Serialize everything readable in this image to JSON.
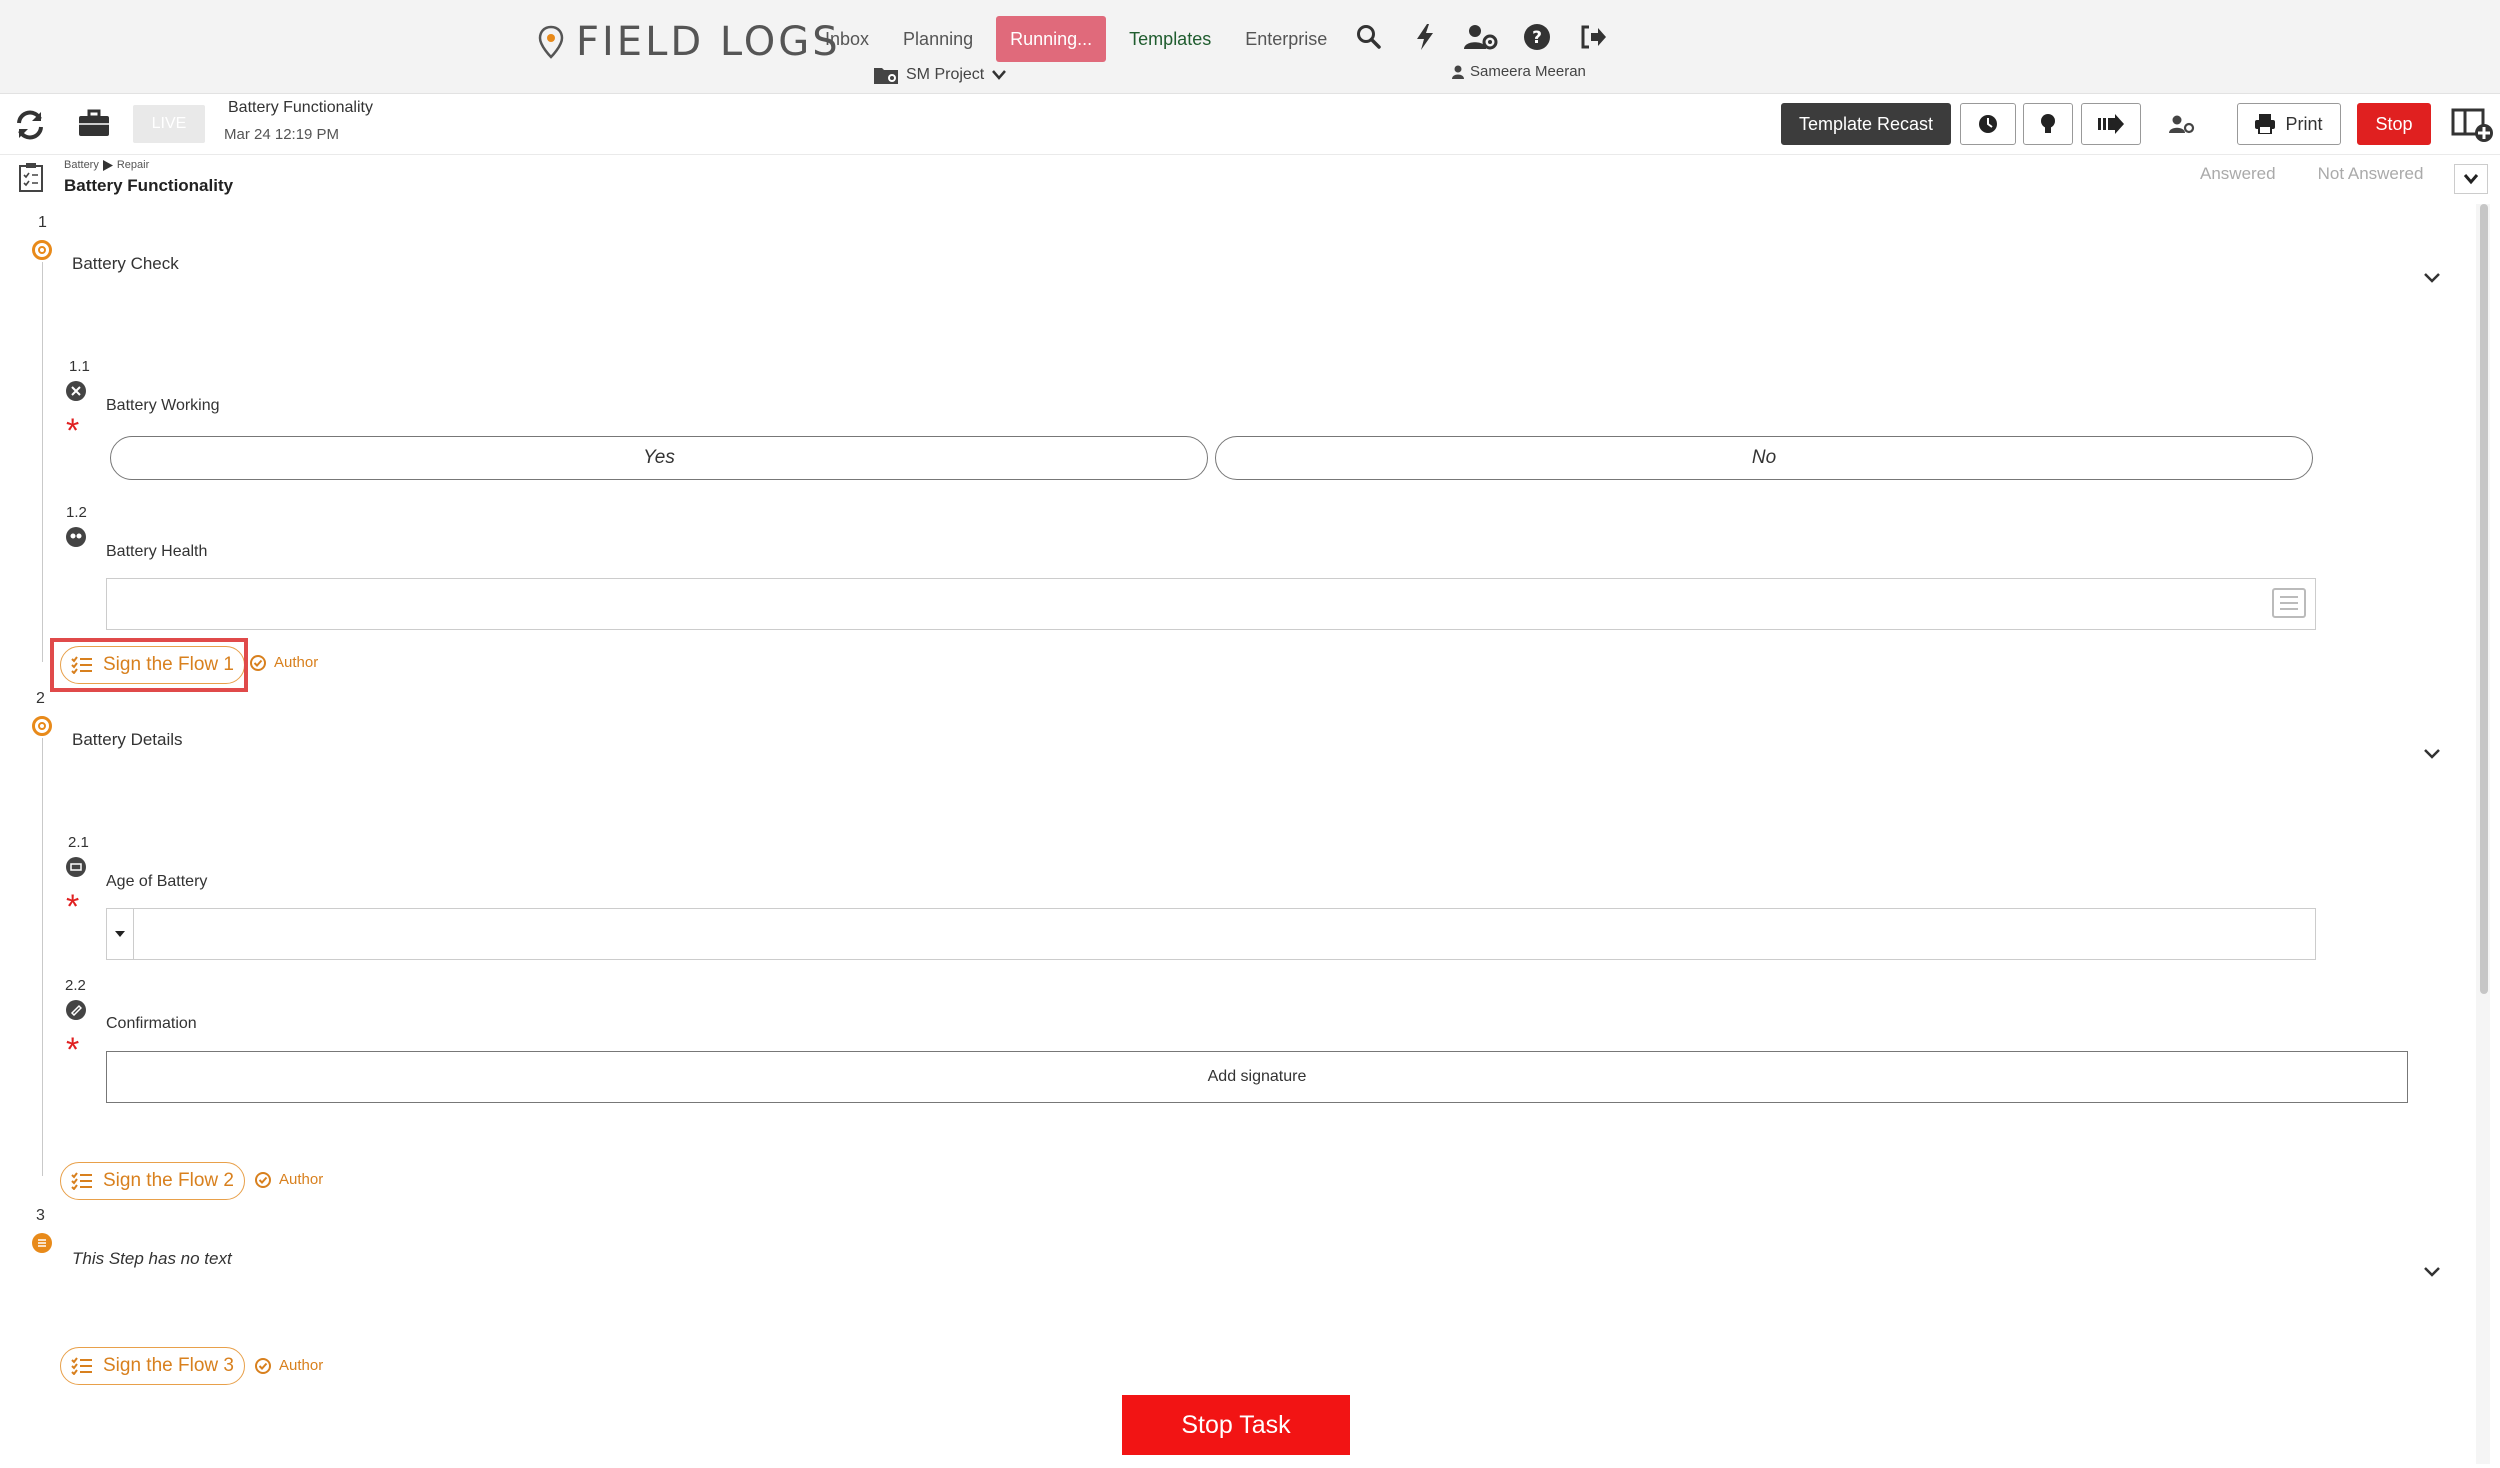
{
  "app": {
    "logo_text": "FIELD LOGS"
  },
  "nav": {
    "items": [
      "Inbox",
      "Planning",
      "Running...",
      "Templates",
      "Enterprise"
    ],
    "project": "SM Project",
    "user": "Sameera Meeran",
    "icons": [
      "search-icon",
      "bolt-icon",
      "user-settings-icon",
      "help-icon",
      "logout-icon"
    ]
  },
  "toolbar": {
    "live": "LIVE",
    "task_title": "Battery Functionality",
    "date": "Mar 24 12:19 PM",
    "template_recast": "Template Recast",
    "print": "Print",
    "stop": "Stop"
  },
  "header": {
    "crumb_parent": "Battery",
    "crumb_child": "Repair",
    "title": "Battery Functionality",
    "answered": "Answered",
    "not_answered": "Not Answered"
  },
  "steps": [
    {
      "number": "1",
      "title": "Battery Check",
      "questions": [
        {
          "number": "1.1",
          "label": "Battery Working",
          "options": [
            "Yes",
            "No"
          ]
        },
        {
          "number": "1.2",
          "label": "Battery Health"
        }
      ],
      "flow": "Sign the Flow 1",
      "author": "Author"
    },
    {
      "number": "2",
      "title": "Battery Details",
      "questions": [
        {
          "number": "2.1",
          "label": "Age of Battery"
        },
        {
          "number": "2.2",
          "label": "Confirmation",
          "button": "Add signature"
        }
      ],
      "flow": "Sign the Flow 2",
      "author": "Author"
    },
    {
      "number": "3",
      "title": "This Step has no text",
      "flow": "Sign the Flow 3",
      "author": "Author"
    }
  ],
  "stop_task": "Stop Task",
  "colors": {
    "accent_orange": "#d8801e",
    "running_tab": "#e06a7b",
    "stop_red": "#e02020",
    "required": "#e02020"
  }
}
